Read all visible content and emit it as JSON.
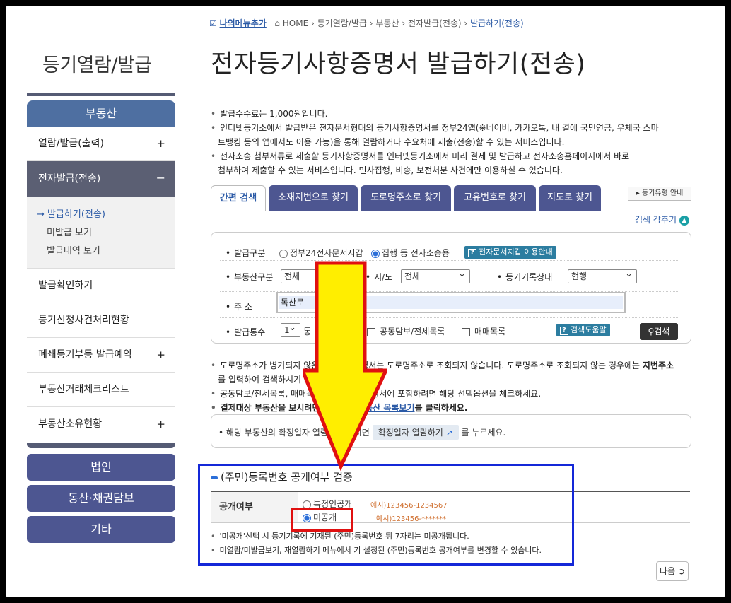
{
  "sidebar": {
    "title": "등기열람/발급",
    "section": "부동산",
    "items": [
      {
        "label": "열람/발급(출력)",
        "plus": "+"
      },
      {
        "label": "전자발급(전송)",
        "plus": "−"
      },
      {
        "label": "발급확인하기"
      },
      {
        "label": "등기신청사건처리현황"
      },
      {
        "label": "폐쇄등기부등 발급예약",
        "plus": "+"
      },
      {
        "label": "부동산거래체크리스트"
      },
      {
        "label": "부동산소유현황",
        "plus": "+"
      }
    ],
    "subitems": [
      "→ 발급하기(전송)",
      "미발급 보기",
      "발급내역 보기"
    ],
    "buttons": [
      "법인",
      "동산·채권담보",
      "기타"
    ]
  },
  "breadcrumb": {
    "mymenu": "나의메뉴추가",
    "path": [
      "HOME",
      "등기열람/발급",
      "부동산",
      "전자발급(전송)"
    ],
    "current": "발급하기(전송)",
    "sep": "›"
  },
  "page_title": "전자등기사항증명서 발급하기(전송)",
  "intro": [
    "발급수수료는 1,000원입니다.",
    "인터넷등기소에서 발급받은 전자문서형태의 등기사항증명서를 정부24앱(※네이버, 카카오톡, 내 곁에 국민연금, 우체국 스마",
    "트뱅킹 등의 앱에서도 이용 가능)을 통해 열람하거나 수요처에 제출(전송)할 수 있는 서비스입니다.",
    "전자소송 첨부서류로 제출할 등기사항증명서를 인터넷등기소에서 미리 결제 및 발급하고 전자소송홈페이지에서 바로",
    "첨부하여 제출할 수 있는 서비스입니다. 민사집행, 비송, 보전처분 사건에만 이용하실 수 있습니다."
  ],
  "tabs": [
    "간편 검색",
    "소재지번으로 찾기",
    "도로명주소로 찾기",
    "고유번호로 찾기",
    "지도로 찾기"
  ],
  "guide_button": "등기유형 안내",
  "hide_search": "검색 감추기",
  "form": {
    "issue_type_label": "발급구분",
    "issue_options": [
      "정부24전자문서지갑",
      "집행 등 전자소송용"
    ],
    "issue_help": "전자문서지갑 이용안내",
    "prop_type_label": "부동산구분",
    "prop_type_value": "전체",
    "sido_label": "시/도",
    "sido_value": "전체",
    "record_state_label": "등기기록상태",
    "record_state_value": "현행",
    "address_label": "주 소",
    "address_value": "독산로",
    "count_label": "발급통수",
    "count_value": "1",
    "count_suffix": "통",
    "check_joint": "공동담보/전세목록",
    "check_trade": "매매목록",
    "search_help": "검색도움말",
    "search_button": "검색"
  },
  "notes": [
    "도로명주소가 병기되지 않은 등기사항증명서는 도로명주소로 조회되지 않습니다. 도로명주소로 조회되지 않는 경우에는",
    "지번주소",
    "를 입력하여 검색하시기 바랍니다.",
    "공동담보/전세목록, 매매목록을 등기사항증명서에 포함하려면 해당 선택옵션을 체크하세요.",
    "결제대상 부동산을 보시려면",
    "결제대상 부동산 목록보기",
    "를 클릭하세요."
  ],
  "notebox": {
    "text1": "해당 부동산의 확정일자 열람을 원하시면",
    "button": "확정일자 열람하기",
    "text2": "를 누르세요."
  },
  "verification": {
    "title": "(주민)등록번호 공개여부 검증",
    "label": "공개여부",
    "options": [
      "특정인공개",
      "미공개"
    ],
    "examples": [
      "예시)123456-1234567",
      "예시)123456-*******"
    ],
    "notes": [
      "'미공개'선택 시 등기기록에 기재된 (주민)등록번호 뒤 7자리는 미공개됩니다.",
      "미열람/미발급보기, 재열람하기 메뉴에서 기 설정된 (주민)등록번호 공개여부를 변경할 수 있습니다."
    ]
  },
  "next_button": "다음",
  "colors": {
    "nav_blue": "#4e6fa1",
    "nav_purple": "#4d5691",
    "annotation_blue": "#1428d8",
    "annotation_red": "#e01010",
    "arrow_yellow": "#ffee00"
  }
}
